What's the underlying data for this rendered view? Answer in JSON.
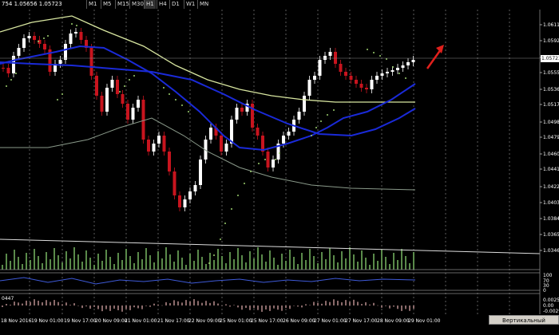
{
  "header": {
    "symbol_info": "754 1.05656 1.05723",
    "timeframes": [
      "M1",
      "M5",
      "M15",
      "M30",
      "H1",
      "H4",
      "D1",
      "W1",
      "MN"
    ],
    "active_timeframe": "H1"
  },
  "price_axis": {
    "labels": [
      "1.06115",
      "1.05925",
      "1.05723",
      "1.05550",
      "1.05360",
      "1.05170",
      "1.04980",
      "1.04790",
      "1.04600",
      "1.04410",
      "1.04220",
      "1.04030",
      "1.03840",
      "1.03650",
      "1.03465"
    ],
    "current_price": "1.05723"
  },
  "time_axis": {
    "labels": [
      "18 Nov 2016",
      "19 Nov 01:00",
      "19 Nov 17:00",
      "20 Nov 09:00",
      "21 Nov 01:00",
      "21 Nov 17:00",
      "22 Nov 09:00",
      "25 Nov 01:00",
      "25 Nov 17:00",
      "26 Nov 09:00",
      "27 Nov 01:00",
      "27 Nov 17:00",
      "28 Nov 09:00",
      "29 Nov 01:00"
    ]
  },
  "sub_windows": {
    "rsi_scale": [
      "100",
      "70",
      "30",
      "0"
    ],
    "macd_scale": [
      "0.00253",
      "0.00",
      "-0.00298"
    ],
    "macd_label": "0447"
  },
  "buttons": {
    "vertical_scale": "Вертикальный масштаб"
  },
  "colors": {
    "background": "#000000",
    "ma_blue": "#1a2ad8",
    "ma_yellow": "#d8e6a0",
    "arrow": "#e0201c",
    "candle_up": "#ffffff",
    "candle_down": "#c8141e"
  }
}
